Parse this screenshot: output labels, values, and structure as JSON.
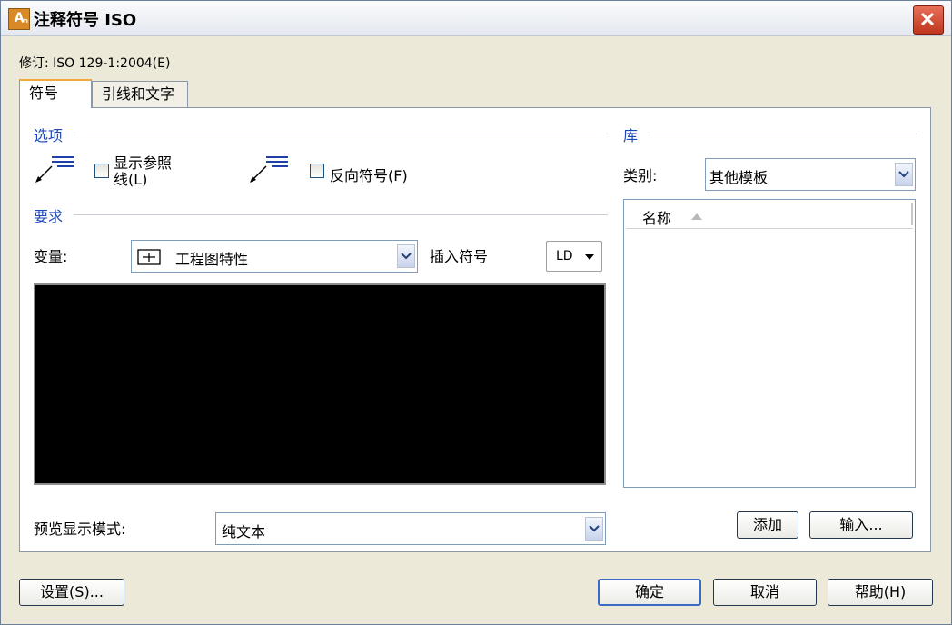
{
  "window": {
    "title": "注释符号 ISO",
    "icon_letter": "A",
    "icon_sub": "m"
  },
  "revision": "修订: ISO 129-1:2004(E)",
  "tabs": [
    {
      "label": "符号"
    },
    {
      "label": "引线和文字"
    }
  ],
  "options": {
    "title": "选项",
    "show_reference_line_line1": "显示参照",
    "show_reference_line_line2": "线(L)",
    "reverse_symbol": "反向符号(F)"
  },
  "requirements": {
    "title": "要求",
    "variable_label": "变量:",
    "variable_value": "工程图特性",
    "insert_symbol_label": "插入符号",
    "insert_symbol_value": "LD"
  },
  "preview_mode": {
    "label": "预览显示模式:",
    "value": "纯文本"
  },
  "library": {
    "title": "库",
    "category_label": "类别:",
    "category_value": "其他模板",
    "list_header": "名称",
    "items": []
  },
  "buttons": {
    "add": "添加",
    "import": "输入...",
    "settings": "设置(S)...",
    "ok": "确定",
    "cancel": "取消",
    "help": "帮助(H)"
  }
}
